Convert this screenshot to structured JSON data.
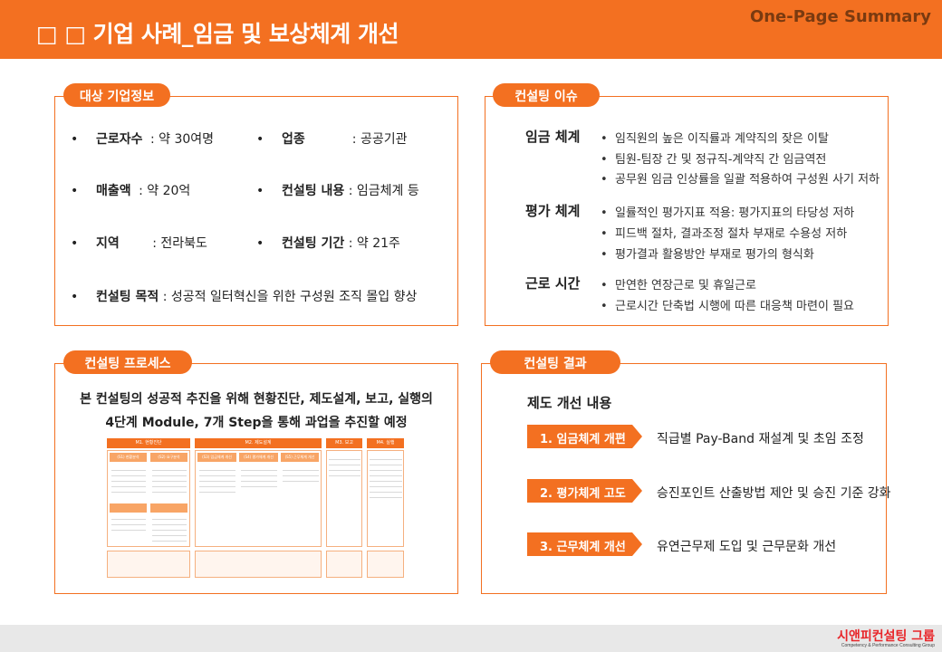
{
  "header": {
    "title": "□ □ 기업 사례_임금 및 보상체계 개선",
    "summary": "One-Page Summary"
  },
  "company": {
    "pill": "대상 기업정보",
    "bullet": "•",
    "rows": [
      {
        "label": "근로자수",
        "sep": " : ",
        "value": "약 30여명",
        "label2": "업종",
        "sep2": ": ",
        "value2": "공공기관"
      },
      {
        "label": "매출액",
        "sep": " : ",
        "value": "약 20억",
        "label2": "컨설팅 내용",
        "sep2": " : ",
        "value2": "임금체계 등"
      },
      {
        "label": "지역",
        "sep": " : ",
        "value": "전라북도",
        "label2": "컨설팅 기간",
        "sep2": " : ",
        "value2": "약 21주"
      }
    ],
    "purpose": {
      "label": "컨설팅 목적",
      "sep": " : ",
      "value": "성공적 일터혁신을 위한 구성원 조직 몰입 향상"
    }
  },
  "issues": {
    "pill": "컨설팅 이슈",
    "dot": "•",
    "groups": [
      {
        "label": "임금 체계",
        "items": [
          "임직원의 높은 이직률과 계약직의 잦은 이탈",
          "팀원-팀장 간 및 정규직-계약직 간 임금역전",
          "공무원 임금 인상률을 일괄 적용하여 구성원 사기 저하"
        ]
      },
      {
        "label": "평가 체계",
        "items": [
          "일률적인 평가지표 적용: 평가지표의 타당성 저하",
          "피드백 절차, 결과조정 절차 부재로 수용성 저하",
          "평가결과 활용방안 부재로 평가의 형식화"
        ]
      },
      {
        "label": "근로 시간",
        "items": [
          "만연한 연장근로 및 휴일근로",
          "근로시간 단축법 시행에 따른 대응책 마련이 필요"
        ]
      }
    ]
  },
  "process": {
    "pill": "컨설팅 프로세스",
    "line1": "본 컨설팅의 성공적 추진을 위해 현황진단, 제도설계, 보고, 실행의",
    "line2": "4단계 Module, 7개 Step을 통해 과업을 추진할 예정",
    "modules": [
      "M1. 현황진단",
      "M2. 제도설계",
      "M3. 보고",
      "M4. 실행"
    ],
    "steps": [
      "(S1) 현황분석",
      "(S2) 요구분석",
      "(S3) 임금체계 개선",
      "(S4) 평가체계 개선",
      "(S5) 근무체계 개선"
    ]
  },
  "results": {
    "pill": "컨설팅 결과",
    "subtitle": "제도 개선 내용",
    "items": [
      {
        "tag": "1. 임금체계 개편",
        "text": "직급별 Pay-Band 재설계 및 초임 조정"
      },
      {
        "tag": "2. 평가체계 고도화",
        "text": "승진포인트 산출방법 제안 및 승진 기준 강화"
      },
      {
        "tag": "3. 근무체계 개선",
        "text": "유연근무제 도입 및 근무문화 개선"
      }
    ]
  },
  "footer": {
    "logo": "시앤피컨설팅 그룹",
    "tagline": "Competency & Performance Consulting Group"
  }
}
